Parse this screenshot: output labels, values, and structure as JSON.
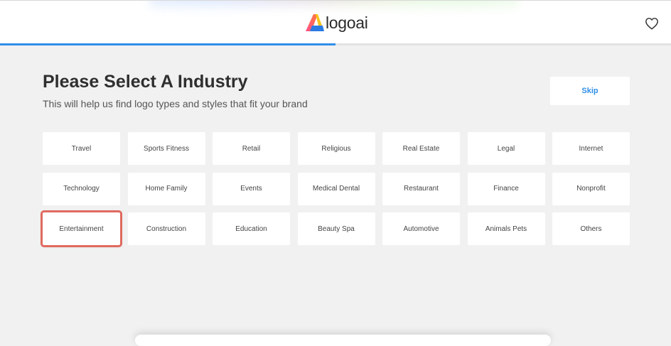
{
  "header": {
    "logo_text": "logoai",
    "favorites_icon": "heart-icon"
  },
  "progress": {
    "fraction": 0.5
  },
  "page": {
    "title": "Please Select A Industry",
    "subtitle": "This will help us find logo types and styles that fit your brand",
    "skip_label": "Skip"
  },
  "industries": [
    "Travel",
    "Sports Fitness",
    "Retail",
    "Religious",
    "Real Estate",
    "Legal",
    "Internet",
    "Technology",
    "Home Family",
    "Events",
    "Medical Dental",
    "Restaurant",
    "Finance",
    "Nonprofit",
    "Entertainment",
    "Construction",
    "Education",
    "Beauty Spa",
    "Automotive",
    "Animals Pets",
    "Others"
  ],
  "highlighted_industry": "Entertainment",
  "colors": {
    "accent": "#2f8fe8",
    "highlight_border": "#e06a5f",
    "background": "#f1f1f1"
  }
}
